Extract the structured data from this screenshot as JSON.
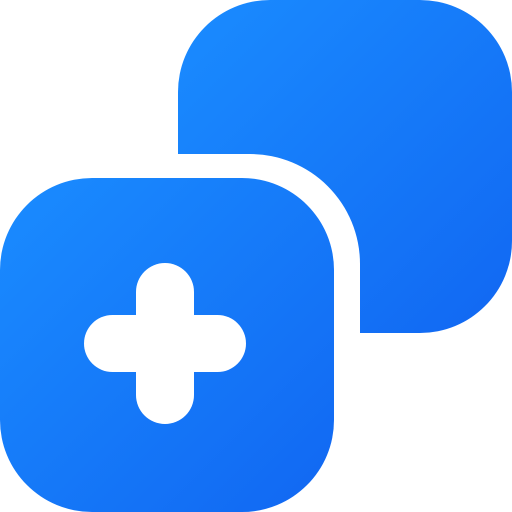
{
  "icon": {
    "name": "add-square-duplicate-icon",
    "gradient_start": "#1a8cff",
    "gradient_end": "#1167f2",
    "background": "#ffffff",
    "plus_color": "#ffffff"
  }
}
